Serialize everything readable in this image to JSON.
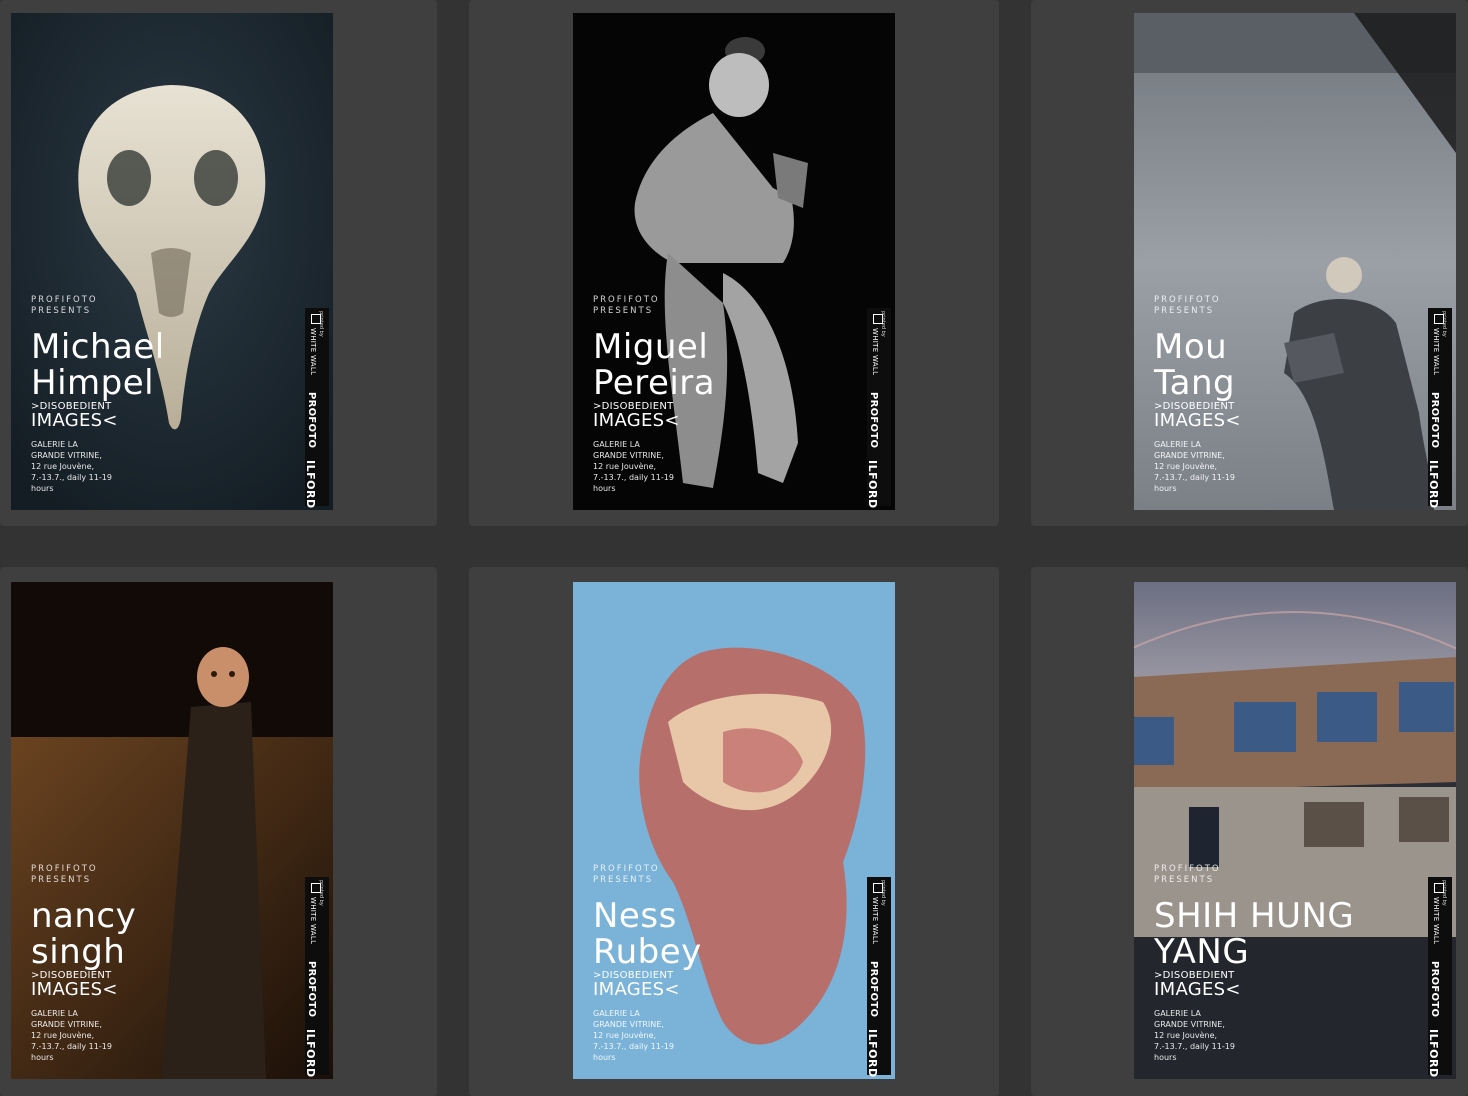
{
  "colors": {
    "page_background": "#333333",
    "card_background": "#3f3f3f",
    "poster_text": "#ffffff",
    "sponsor_bar": "#0d0d0d"
  },
  "posters": [
    {
      "presenter_line1": "PROFIFOTO",
      "presenter_line2": "PRESENTS",
      "name_line1": "Michael",
      "name_line2": "Himpel",
      "title_line1": ">DISOBEDIENT",
      "title_line2": "IMAGES<",
      "venue_line1": "GALERIE LA",
      "venue_line2": "GRANDE VITRINE,",
      "venue_line3": "12 rue Jouvène,",
      "venue_line4": "7.-13.7., daily 11-19",
      "venue_line5": "hours",
      "sponsor_printed_by": "printed by",
      "sponsor_whitewall": "WHITE WALL",
      "sponsor_profoto": "PROFOTO",
      "sponsor_ilford": "ILFORD",
      "image_subject": "bird-skull-icon"
    },
    {
      "presenter_line1": "PROFIFOTO",
      "presenter_line2": "PRESENTS",
      "name_line1": "Miguel",
      "name_line2": "Pereira",
      "title_line1": ">DISOBEDIENT",
      "title_line2": "IMAGES<",
      "venue_line1": "GALERIE LA",
      "venue_line2": "GRANDE VITRINE,",
      "venue_line3": "12 rue Jouvène,",
      "venue_line4": "7.-13.7., daily 11-19",
      "venue_line5": "hours",
      "sponsor_printed_by": "printed by",
      "sponsor_whitewall": "WHITE WALL",
      "sponsor_profoto": "PROFOTO",
      "sponsor_ilford": "ILFORD",
      "image_subject": "stuffed-effigy-icon"
    },
    {
      "presenter_line1": "PROFIFOTO",
      "presenter_line2": "PRESENTS",
      "name_line1": "Mou",
      "name_line2": "Tang",
      "title_line1": ">DISOBEDIENT",
      "title_line2": "IMAGES<",
      "venue_line1": "GALERIE LA",
      "venue_line2": "GRANDE VITRINE,",
      "venue_line3": "12 rue Jouvène,",
      "venue_line4": "7.-13.7., daily 11-19",
      "venue_line5": "hours",
      "sponsor_printed_by": "printed by",
      "sponsor_whitewall": "WHITE WALL",
      "sponsor_profoto": "PROFOTO",
      "sponsor_ilford": "ILFORD",
      "image_subject": "boy-on-field-icon"
    },
    {
      "presenter_line1": "PROFIFOTO",
      "presenter_line2": "PRESENTS",
      "name_line1": "nancy",
      "name_line2": "singh",
      "title_line1": ">DISOBEDIENT",
      "title_line2": "IMAGES<",
      "venue_line1": "GALERIE LA",
      "venue_line2": "GRANDE VITRINE,",
      "venue_line3": "12 rue Jouvène,",
      "venue_line4": "7.-13.7., daily 11-19",
      "venue_line5": "hours",
      "sponsor_printed_by": "printed by",
      "sponsor_whitewall": "WHITE WALL",
      "sponsor_profoto": "PROFOTO",
      "sponsor_ilford": "ILFORD",
      "image_subject": "doll-head-on-post-icon"
    },
    {
      "presenter_line1": "PROFIFOTO",
      "presenter_line2": "PRESENTS",
      "name_line1": "Ness",
      "name_line2": "Rubey",
      "title_line1": ">DISOBEDIENT",
      "title_line2": "IMAGES<",
      "venue_line1": "GALERIE LA",
      "venue_line2": "GRANDE VITRINE,",
      "venue_line3": "12 rue Jouvène,",
      "venue_line4": "7.-13.7., daily 11-19",
      "venue_line5": "hours",
      "sponsor_printed_by": "printed by",
      "sponsor_whitewall": "WHITE WALL",
      "sponsor_profoto": "PROFOTO",
      "sponsor_ilford": "ILFORD",
      "image_subject": "organs-icon"
    },
    {
      "presenter_line1": "PROFIFOTO",
      "presenter_line2": "PRESENTS",
      "name_line1": "SHIH HUNG",
      "name_line2": "YANG",
      "title_line1": ">DISOBEDIENT",
      "title_line2": "IMAGES<",
      "venue_line1": "GALERIE LA",
      "venue_line2": "GRANDE VITRINE,",
      "venue_line3": "12 rue Jouvène,",
      "venue_line4": "7.-13.7., daily 11-19",
      "venue_line5": "hours",
      "sponsor_printed_by": "printed by",
      "sponsor_whitewall": "WHITE WALL",
      "sponsor_profoto": "PROFOTO",
      "sponsor_ilford": "ILFORD",
      "image_subject": "brick-building-rainbow-icon"
    }
  ]
}
